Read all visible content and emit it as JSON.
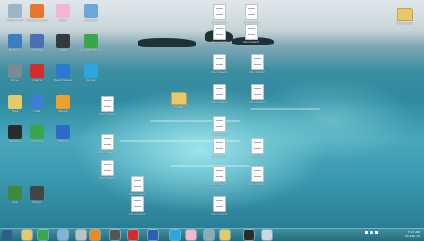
{
  "desktop": {
    "left_icons": [
      {
        "name": "recycle-bin-icon",
        "label": "Recycle Bin",
        "color": "#9fb4c4"
      },
      {
        "name": "firefox-icon",
        "label": "Mozilla Firefox",
        "color": "#e8762b"
      },
      {
        "name": "paint-icon",
        "label": "Paint",
        "color": "#f3b6d1"
      },
      {
        "name": "notepad-icon",
        "label": "Notepad",
        "color": "#6aa8d8"
      },
      {
        "name": "network-icon",
        "label": "Network",
        "color": "#3b7ec2"
      },
      {
        "name": "settings-icon",
        "label": "Settings",
        "color": "#4b6fb4"
      },
      {
        "name": "video-icon",
        "label": "Video",
        "color": "#333a3c"
      },
      {
        "name": "chrome-icon",
        "label": "Google Chrome",
        "color": "#3aa64a"
      },
      {
        "name": "drive-icon",
        "label": "Drive",
        "color": "#7c8a94"
      },
      {
        "name": "opera-icon",
        "label": "Opera",
        "color": "#d62b2b"
      },
      {
        "name": "teamviewer-icon",
        "label": "TeamViewer",
        "color": "#2b78d6"
      },
      {
        "name": "skype-icon",
        "label": "Skype",
        "color": "#2aa7e0"
      },
      {
        "name": "folder-icon",
        "label": "Files",
        "color": "#e8c96a"
      },
      {
        "name": "chat-icon",
        "label": "Chat",
        "color": "#3a7fd0"
      },
      {
        "name": "media-icon",
        "label": "Media",
        "color": "#f0a029"
      },
      {
        "name": "terminal-icon",
        "label": "Console",
        "color": "#2b2b2b"
      },
      {
        "name": "chrome-icon",
        "label": "Chrome",
        "color": "#3aa64a"
      },
      {
        "name": "photos-icon",
        "label": "Photos",
        "color": "#2f6ac8"
      },
      {
        "name": "app-icon",
        "label": "App",
        "color": "#3c8a3c"
      },
      {
        "name": "player-icon",
        "label": "Player",
        "color": "#444"
      }
    ],
    "middle_icons": [
      {
        "name": "document-icon",
        "label": "Document"
      },
      {
        "name": "document-icon",
        "label": "Document"
      },
      {
        "name": "document-icon",
        "label": "Document"
      },
      {
        "name": "document-icon",
        "label": "Document"
      },
      {
        "name": "folder-icon",
        "label": "Folder"
      },
      {
        "name": "document-icon",
        "label": "Document"
      },
      {
        "name": "document-icon",
        "label": "Document"
      },
      {
        "name": "document-icon",
        "label": "Document"
      },
      {
        "name": "document-icon",
        "label": "Document"
      },
      {
        "name": "document-icon",
        "label": "Document"
      },
      {
        "name": "document-icon",
        "label": "Document"
      },
      {
        "name": "document-icon",
        "label": "Document"
      },
      {
        "name": "document-icon",
        "label": "Document"
      },
      {
        "name": "document-icon",
        "label": "Document"
      },
      {
        "name": "document-icon",
        "label": "Document"
      },
      {
        "name": "document-icon",
        "label": "Document"
      },
      {
        "name": "document-icon",
        "label": "Document"
      },
      {
        "name": "document-icon",
        "label": "Document"
      },
      {
        "name": "document-icon",
        "label": "Document"
      },
      {
        "name": "document-icon",
        "label": "Document"
      }
    ],
    "right_icon": {
      "name": "folder-icon",
      "label": "New folder"
    }
  },
  "taskbar": {
    "buttons": [
      {
        "name": "start-button",
        "color": "#2b5f8a"
      },
      {
        "name": "explorer-taskbar-icon",
        "color": "#e8c96a"
      },
      {
        "name": "chrome-taskbar-icon",
        "color": "#3aa64a"
      },
      {
        "name": "store-taskbar-icon",
        "color": "#7fb4d6"
      },
      {
        "name": "app-taskbar-icon",
        "color": "#c0c0c0"
      },
      {
        "name": "vlc-taskbar-icon",
        "color": "#f08a1f"
      },
      {
        "name": "media-taskbar-icon",
        "color": "#555"
      },
      {
        "name": "opera-taskbar-icon",
        "color": "#d62b2b"
      },
      {
        "name": "word-taskbar-icon",
        "color": "#2b5fb4"
      },
      {
        "name": "skype-taskbar-icon",
        "color": "#2aa7e0"
      },
      {
        "name": "paint-taskbar-icon",
        "color": "#f3b6d1"
      },
      {
        "name": "window-taskbar-icon",
        "color": "#8fa9b6"
      },
      {
        "name": "explorer2-taskbar-icon",
        "color": "#e8c96a"
      },
      {
        "name": "camera-taskbar-icon",
        "color": "#2b2b2b"
      },
      {
        "name": "photos-taskbar-icon",
        "color": "#c9d8e0"
      }
    ],
    "time": "7:17 AM",
    "date": "03-Feb-15"
  }
}
